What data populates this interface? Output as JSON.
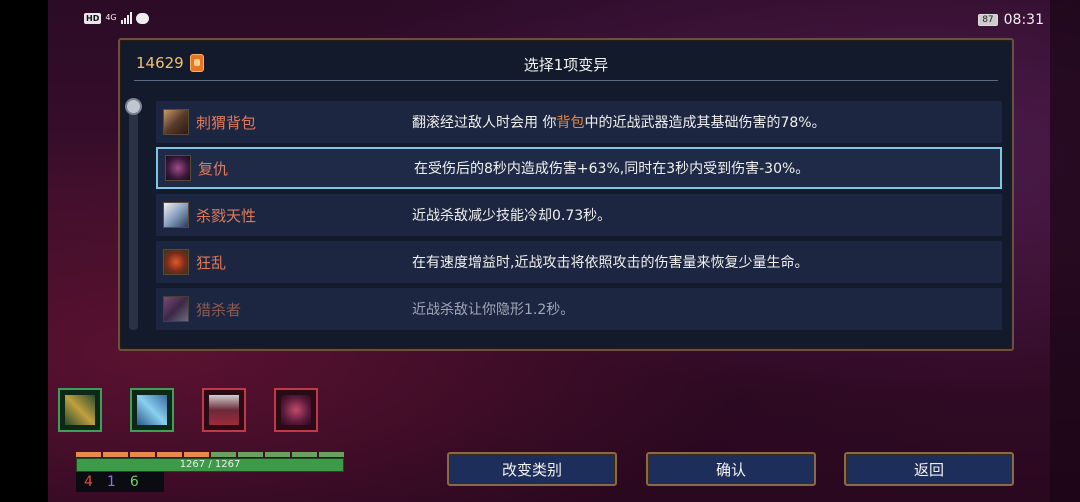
{
  "status_bar": {
    "hd": "HD",
    "network": "4G",
    "battery": "87",
    "time": "08:31"
  },
  "dialog": {
    "gold": "14629",
    "title": "选择1项变异",
    "mutations": [
      {
        "name": "刺猬背包",
        "desc_parts": [
          "翻滚经过敌人时会用 你",
          "背包",
          "中的近战武器造成其基础伤害的78%。"
        ],
        "icon": "hedgehog-backpack-icon",
        "color": "#8a6a5a"
      },
      {
        "name": "复仇",
        "desc_parts": [
          "在受伤后的8秒内造成伤害+63%,同时在3秒内受到伤害-30%。"
        ],
        "icon": "vengeance-icon",
        "color": "#6a3a6a"
      },
      {
        "name": "杀戮天性",
        "desc_parts": [
          "近战杀敌减少技能冷却0.73秒。"
        ],
        "icon": "killer-instinct-icon",
        "color": "#b0b8c8"
      },
      {
        "name": "狂乱",
        "desc_parts": [
          "在有速度增益时,近战攻击将依照攻击的伤害量来恢复少量生命。"
        ],
        "icon": "frenzy-icon",
        "color": "#b04a2a"
      },
      {
        "name": "猎杀者",
        "desc_parts": [
          "近战杀敌让你隐形1.2秒。"
        ],
        "icon": "predator-icon",
        "color": "#7a4a6a"
      }
    ]
  },
  "skills": [
    {
      "icon": "bow-skill-icon",
      "style": "green"
    },
    {
      "icon": "ice-shard-skill-icon",
      "style": "green"
    },
    {
      "icon": "turret-skill-icon",
      "style": "red"
    },
    {
      "icon": "grenade-skill-icon",
      "style": "red"
    }
  ],
  "health": {
    "text": "1267 / 1267",
    "fraction": 1.0
  },
  "stats": {
    "brutality": "4",
    "tactics": "1",
    "survival": "6"
  },
  "buttons": {
    "change_category": "改变类别",
    "confirm": "确认",
    "back": "返回"
  }
}
